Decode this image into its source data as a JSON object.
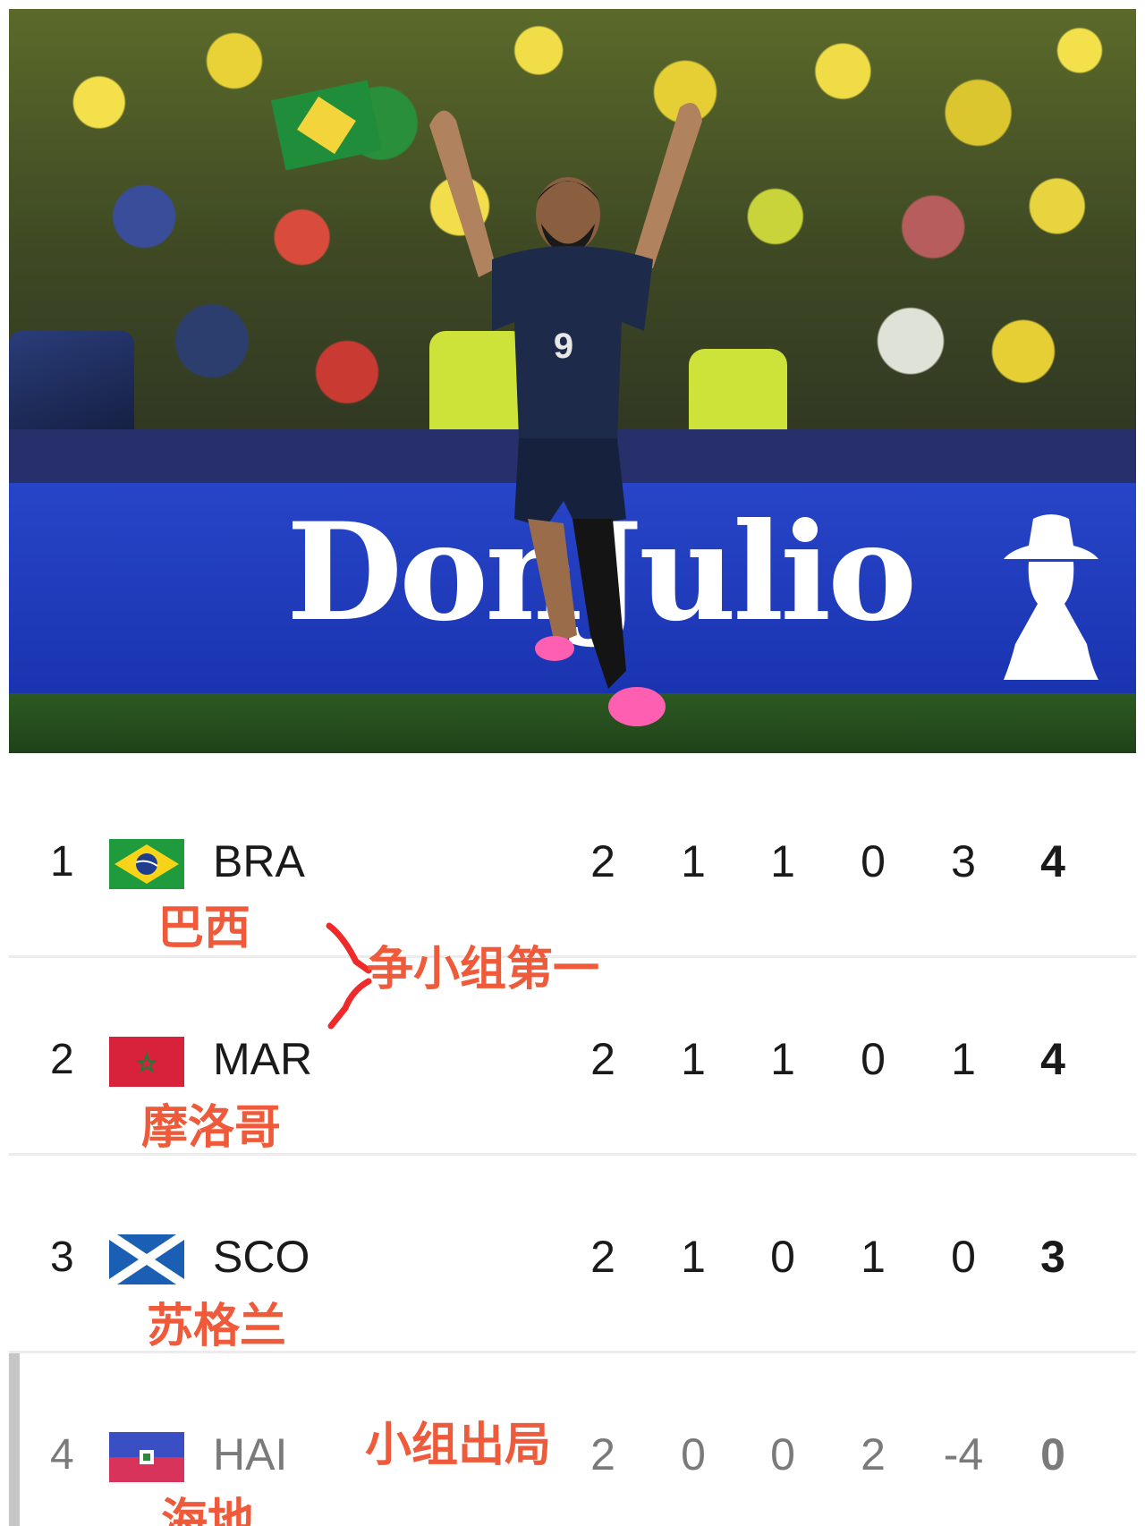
{
  "photo": {
    "board_text": "DonJulio",
    "shirt_number": "9"
  },
  "standings": [
    {
      "rank": "1",
      "code": "BRA",
      "name_cn": "巴西",
      "stats": [
        "2",
        "1",
        "1",
        "0",
        "3",
        "4"
      ],
      "flag": "brazil-flag"
    },
    {
      "rank": "2",
      "code": "MAR",
      "name_cn": "摩洛哥",
      "stats": [
        "2",
        "1",
        "1",
        "0",
        "1",
        "4"
      ],
      "flag": "morocco-flag"
    },
    {
      "rank": "3",
      "code": "SCO",
      "name_cn": "苏格兰",
      "stats": [
        "2",
        "1",
        "0",
        "1",
        "0",
        "3"
      ],
      "flag": "scotland-flag"
    },
    {
      "rank": "4",
      "code": "HAI",
      "name_cn": "海地",
      "stats": [
        "2",
        "0",
        "0",
        "2",
        "-4",
        "0"
      ],
      "flag": "haiti-flag"
    }
  ],
  "annotations": {
    "top_note": "争小组第一",
    "out_note": "小组出局"
  },
  "colors": {
    "annotation": "#ee5a3a",
    "board": "#2745c8"
  }
}
